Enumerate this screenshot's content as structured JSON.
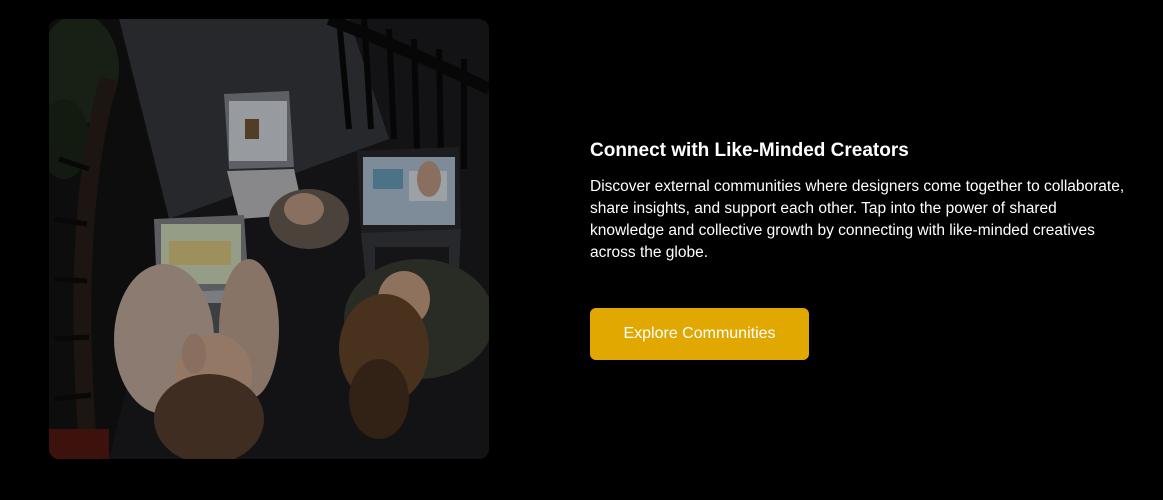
{
  "section": {
    "heading": "Connect with Like-Minded Creators",
    "description": "Discover external communities where designers come together to collaborate, share insights, and support each other. Tap into the power of shared knowledge and collective growth by connecting with like-minded creatives across the globe.",
    "button_label": "Explore Communities"
  },
  "colors": {
    "background": "#000000",
    "button": "#e0a800",
    "text": "#ffffff"
  },
  "image": {
    "alt": "",
    "icon": "photo-people-with-laptops"
  }
}
